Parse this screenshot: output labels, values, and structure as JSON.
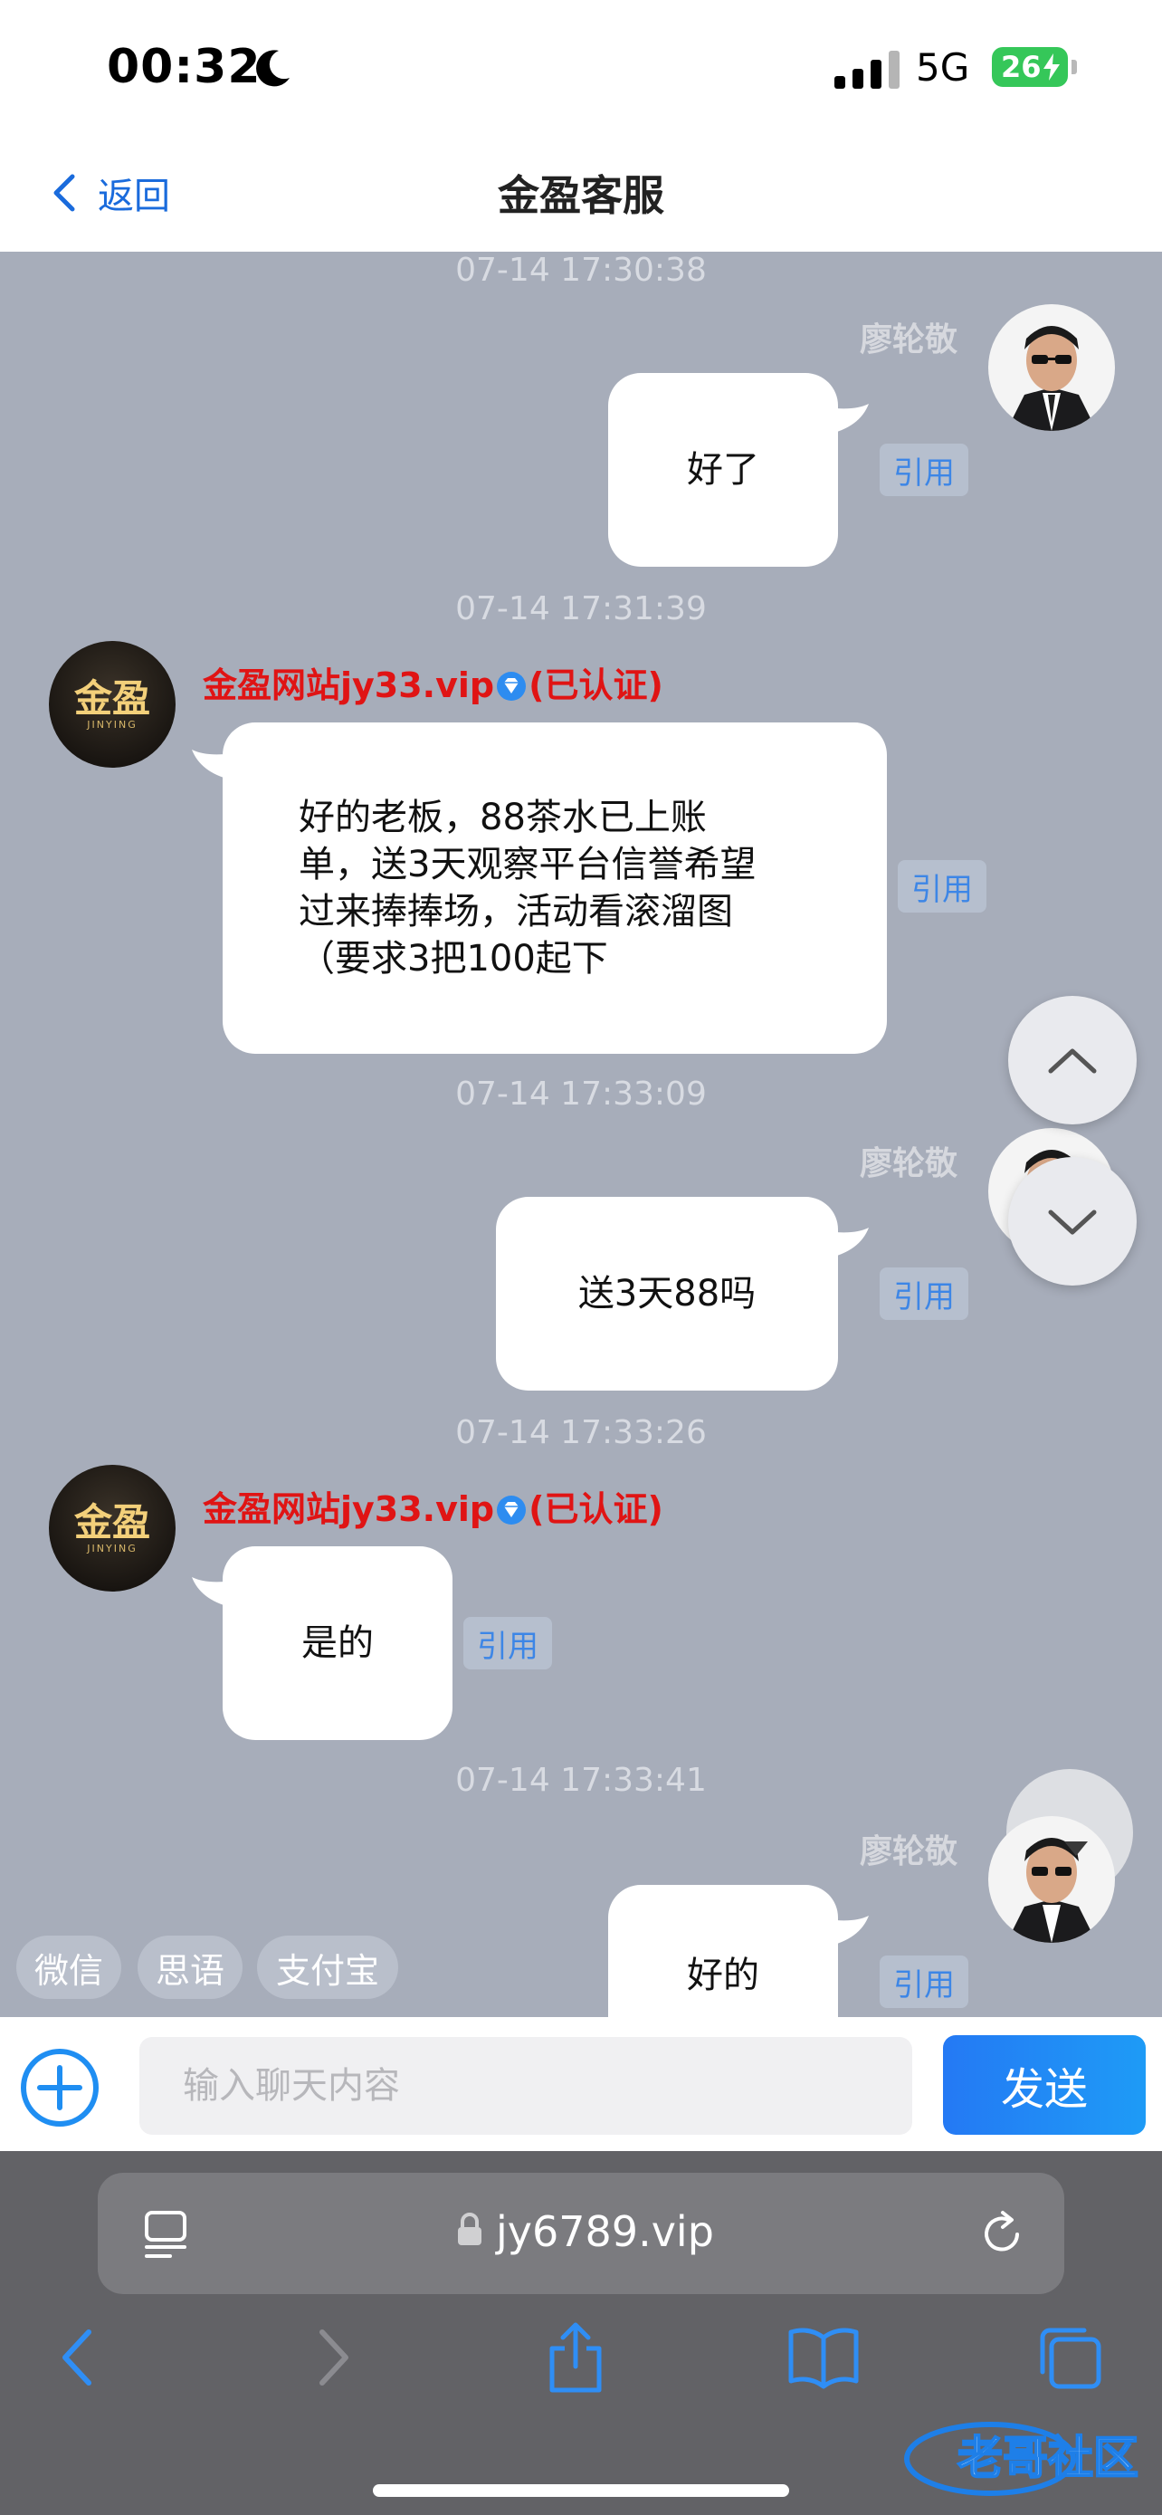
{
  "status": {
    "time": "00:32",
    "network": "5G",
    "battery": "26"
  },
  "nav": {
    "back_label": "返回",
    "title": "金盈客服"
  },
  "messages": [
    {
      "timestamp": "07-14 17:30:38",
      "sender": "廖轮敬",
      "text": "好了",
      "quote": "引用"
    },
    {
      "timestamp": "07-14 17:31:39",
      "sender_name": "金盈网站jy33.vip",
      "sender_badge": "(已认证)",
      "lines": [
        "好的老板，88茶水已上账",
        "单，送3天观察平台信誉希望",
        "过来捧捧场，活动看滚溜图",
        "（要求3把100起下"
      ],
      "quote": "引用"
    },
    {
      "timestamp": "07-14 17:33:09",
      "sender": "廖轮敬",
      "text": "送3天88吗",
      "quote": "引用"
    },
    {
      "timestamp": "07-14 17:33:26",
      "sender_name": "金盈网站jy33.vip",
      "sender_badge": "(已认证)",
      "text": "是的",
      "quote": "引用"
    },
    {
      "timestamp": "07-14 17:33:41",
      "sender": "廖轮敬",
      "text": "好的",
      "quote": "引用"
    }
  ],
  "bot_logo": {
    "text": "金盈",
    "sub": "JINYING"
  },
  "quick_replies": [
    "微信",
    "思语",
    "支付宝"
  ],
  "input": {
    "placeholder": "输入聊天内容",
    "value": "",
    "send_label": "发送"
  },
  "browser": {
    "url": "jy6789.vip"
  },
  "watermark": "老哥社区",
  "colors": {
    "chat_bg": "#a7adba",
    "accent": "#1a6bdc",
    "send": "#2479f4",
    "verified": "#e01414"
  }
}
